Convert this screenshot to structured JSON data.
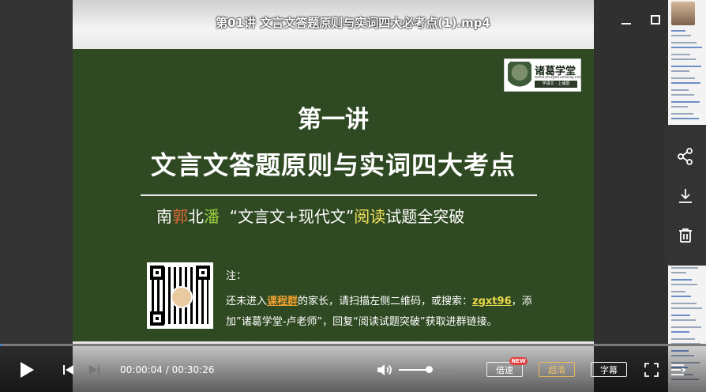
{
  "window": {
    "title": "第01讲 文言文答题原则与实词四大必考点(1).mp4",
    "minimize_icon": "minimize-icon",
    "maximize_icon": "maximize-icon",
    "close_icon": "close-icon"
  },
  "slide": {
    "logo": {
      "name": "诸葛学堂",
      "url": "www.zhugexuetang.com",
      "slogan": "学语文 · 上诸葛"
    },
    "title_line1": "第一讲",
    "title_line2": "文言文答题原则与实词四大考点",
    "subtitle": {
      "p1": "南",
      "p2": "郭",
      "p3": "北",
      "p4": "潘",
      "p5": "“文言文+现代文”",
      "p6": "阅读",
      "p7": "试题全突破"
    },
    "note": {
      "label": "注：",
      "line1_a": "还未进入",
      "line1_link": "课程群",
      "line1_b": "的家长，请扫描左侧二维码，或搜索：",
      "line1_code": "zgxt96",
      "line1_c": "，添",
      "line2": "加”诸葛学堂-卢老师”，回复“阅读试题突破”获取进群链接。"
    }
  },
  "side_panel": {
    "share_icon": "share-icon",
    "download_icon": "download-icon",
    "delete_icon": "trash-icon"
  },
  "controls": {
    "current_time": "00:00:04",
    "separator": " / ",
    "duration": "00:30:26",
    "progress_fraction": 0.002,
    "volume_fraction": 0.51,
    "speed_label": "倍速",
    "speed_badge": "NEW",
    "quality_label": "超清",
    "subtitle_label": "字幕",
    "accent": "#2f7de1"
  }
}
